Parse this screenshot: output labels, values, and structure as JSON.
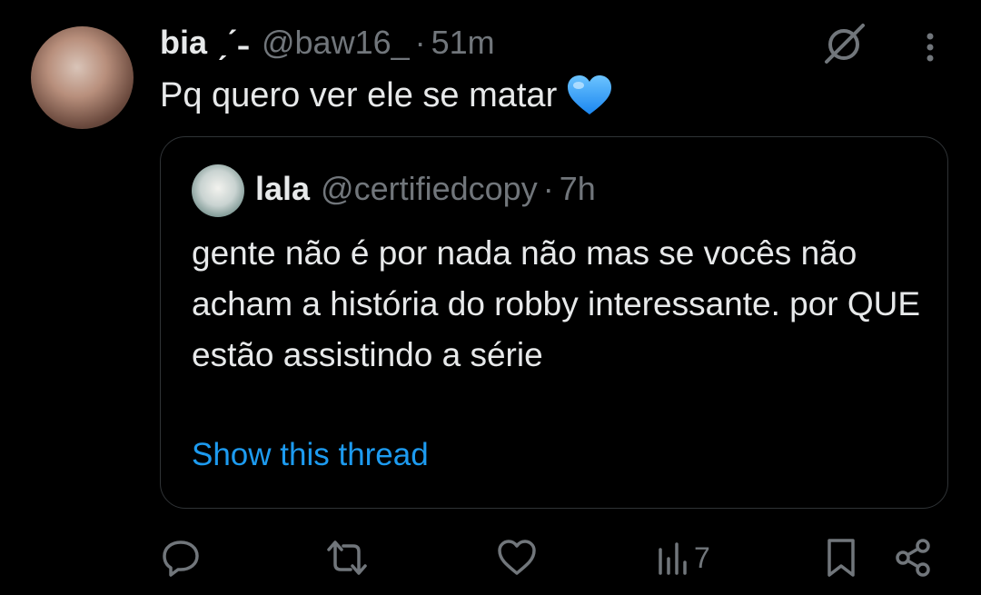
{
  "tweet": {
    "author_name": "bia ˏˊ˗",
    "author_handle": "@baw16_",
    "separator": "·",
    "time": "51m",
    "text": "Pq quero ver ele se matar",
    "emoji": "blue-heart"
  },
  "quoted": {
    "author_name": "lala",
    "author_handle": "@certifiedcopy",
    "separator": "·",
    "time": "7h",
    "text": "gente não é por nada não mas se vocês não acham a história do robby interessante. por QUE estão assistindo a série",
    "link": "Show this thread"
  },
  "actions": {
    "views": "7"
  },
  "colors": {
    "background": "#000000",
    "text": "#e7e9ea",
    "muted": "#71767b",
    "link": "#1d9bf0",
    "heart": "#2fa0ff"
  },
  "icons": [
    "grok-icon",
    "more-icon",
    "reply-icon",
    "retweet-icon",
    "like-icon",
    "views-icon",
    "bookmark-icon",
    "share-icon"
  ]
}
